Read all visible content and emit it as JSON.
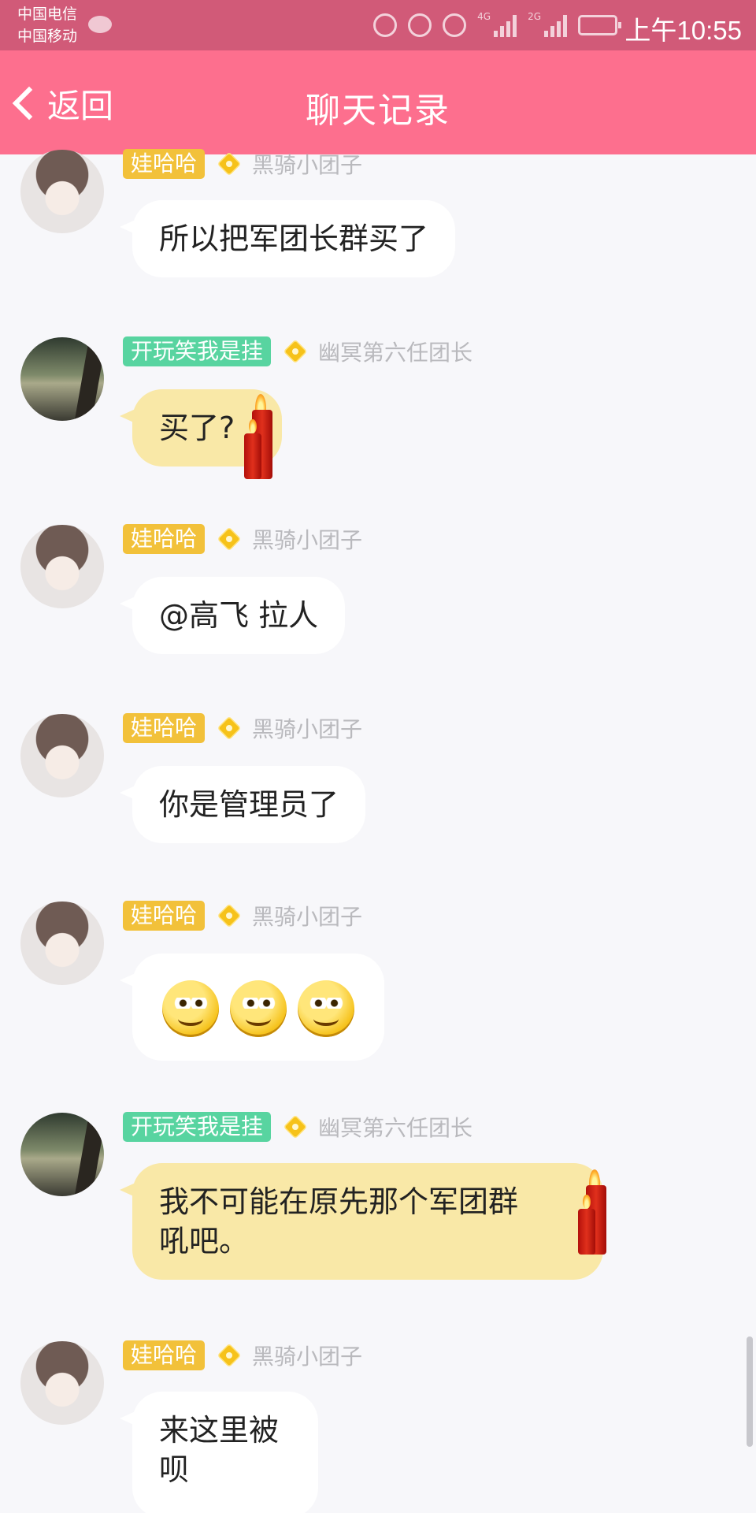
{
  "status_bar": {
    "carrier_1": "中国电信",
    "carrier_2": "中国移动",
    "network_1": "4G",
    "network_2": "2G",
    "time": "上午10:55",
    "icons": [
      "message-icon",
      "mute-icon",
      "alarm-icon",
      "eye-icon",
      "signal-icon",
      "signal-icon",
      "battery-icon"
    ]
  },
  "header": {
    "back_label": "返回",
    "title": "聊天记录",
    "color": "#fd6f8e"
  },
  "messages": [
    {
      "sender_badge": "娃哈哈",
      "sender_title": "黑骑小团子",
      "text": "所以把军团长群买了",
      "bubble": "white"
    },
    {
      "sender_badge": "开玩笑我是挂",
      "sender_title": "幽冥第六任团长",
      "text": "买了?",
      "bubble": "yellow"
    },
    {
      "sender_badge": "娃哈哈",
      "sender_title": "黑骑小团子",
      "text": "@高飞 拉人",
      "bubble": "white"
    },
    {
      "sender_badge": "娃哈哈",
      "sender_title": "黑骑小团子",
      "text": "你是管理员了",
      "bubble": "white"
    },
    {
      "sender_badge": "娃哈哈",
      "sender_title": "黑骑小团子",
      "emoji": [
        "smirk-emoji",
        "smirk-emoji",
        "smirk-emoji"
      ],
      "bubble": "white"
    },
    {
      "sender_badge": "开玩笑我是挂",
      "sender_title": "幽冥第六任团长",
      "text_line_1": "我不可能在原先那个军团群",
      "text_line_2": "吼吧。",
      "bubble": "yellow"
    },
    {
      "sender_badge": "娃哈哈",
      "sender_title": "黑骑小团子",
      "text_line_1": "来这里被",
      "text_line_2": "呗",
      "bubble": "white"
    }
  ]
}
